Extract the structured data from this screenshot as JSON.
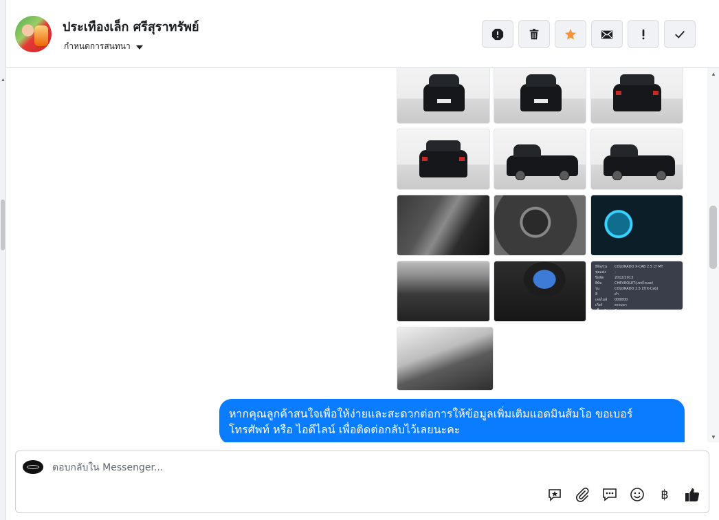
{
  "contact": {
    "name": "ประเทืองเล็ก ศรีสุราทรัพย์",
    "assign_label": "กำหนดการสนทนา"
  },
  "header_actions": [
    {
      "name": "spam-button",
      "icon": "alert-octagon-icon"
    },
    {
      "name": "delete-button",
      "icon": "trash-icon"
    },
    {
      "name": "star-button",
      "icon": "star-icon",
      "color": "#f7923b"
    },
    {
      "name": "mark-unread-button",
      "icon": "envelope-icon"
    },
    {
      "name": "follow-up-button",
      "icon": "exclamation-icon"
    },
    {
      "name": "mark-done-button",
      "icon": "checkmark-icon"
    }
  ],
  "spec_card": {
    "rows": [
      [
        "ยี่ห้อ/รุ่น",
        "COLORADO X-CAB 2.5 LT MT"
      ],
      [
        "ชุดแต่ง",
        "-"
      ],
      [
        "ปีผลิต",
        "2012/2013"
      ],
      [
        "ยี่ห้อ",
        "CHEVROLET(เชฟโรเลต)"
      ],
      [
        "รุ่น",
        "COLORADO 2.5 LT(X-Cab)"
      ],
      [
        "สี",
        "ดำ"
      ],
      [
        "เลขไมล์",
        "000000"
      ],
      [
        "เกียร์",
        "ธรรมดา"
      ],
      [
        "เชื้อเพลิง",
        "ดีเซล"
      ]
    ]
  },
  "message": {
    "line1": "หากคุณลูกค้าสนใจเพื่อให้ง่ายและสะดวกต่อการให้ข้อมูลเพิ่มเติมแอดมินส้มโอ ขอเบอร์",
    "line2": "โทรศัพท์ หรือ ไอดีไลน์ เพื่อติดต่อกลับไว้เลยนะคะ",
    "bubble_color": "#0a7cff"
  },
  "composer": {
    "placeholder": "ตอบกลับใน Messenger..."
  },
  "composer_tools": [
    "saved-reply-icon",
    "paperclip-icon",
    "chat-bubble-icon",
    "smiley-icon",
    "baht-icon",
    "thumbs-up-icon"
  ],
  "baht_symbol": "฿"
}
